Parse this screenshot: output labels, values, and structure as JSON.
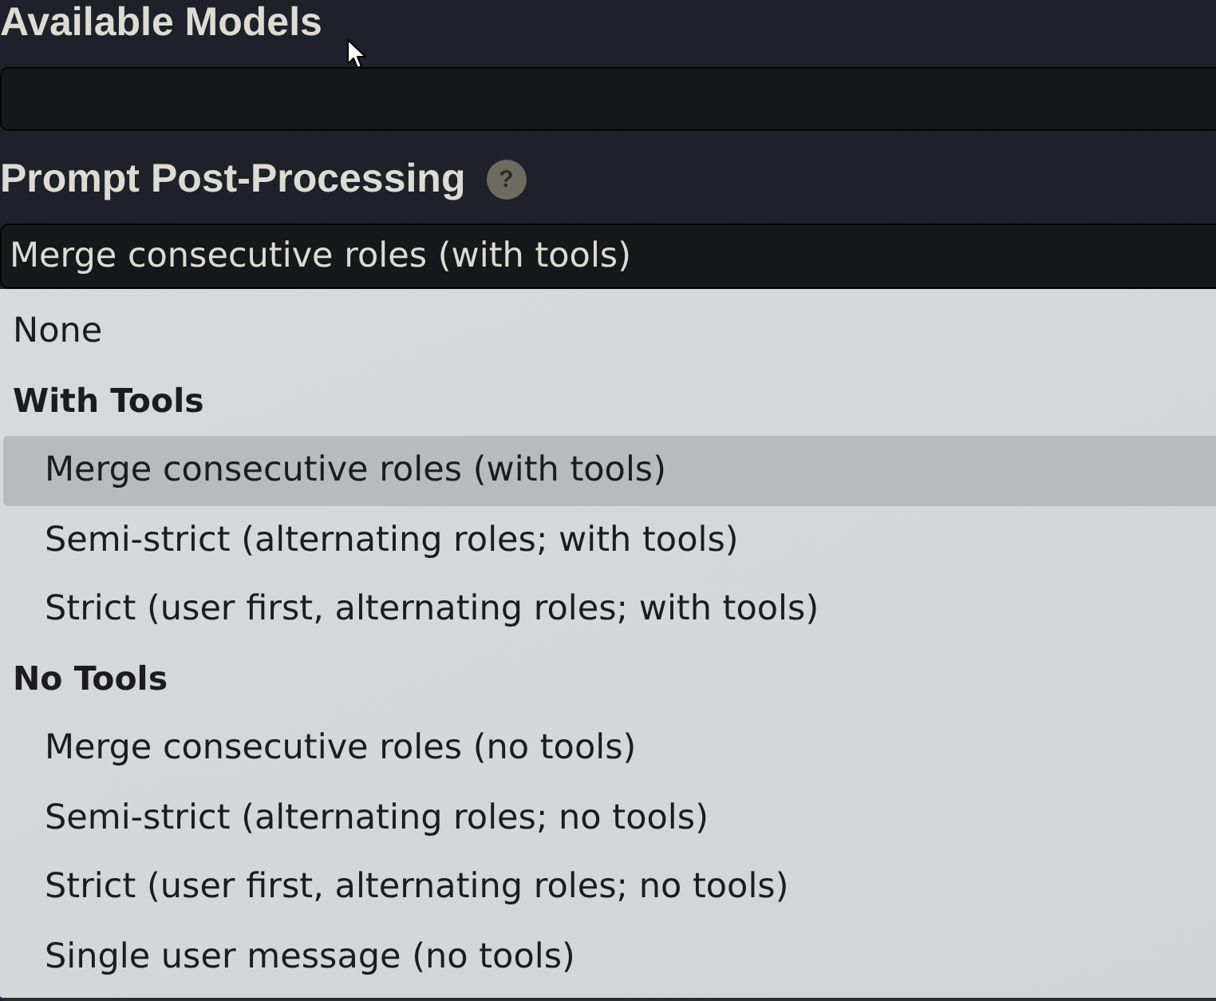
{
  "available_models": {
    "heading": "Available Models"
  },
  "prompt_post_processing": {
    "heading": "Prompt Post-Processing",
    "help": "?",
    "value": "Merge consecutive roles (with tools)",
    "expanded": true,
    "options": [
      {
        "kind": "option",
        "label": "None",
        "selected": false
      },
      {
        "kind": "group",
        "label": "With Tools",
        "children": [
          {
            "kind": "option",
            "label": "Merge consecutive roles (with tools)",
            "selected": true
          },
          {
            "kind": "option",
            "label": "Semi-strict (alternating roles; with tools)",
            "selected": false
          },
          {
            "kind": "option",
            "label": "Strict (user first, alternating roles; with tools)",
            "selected": false
          }
        ]
      },
      {
        "kind": "group",
        "label": "No Tools",
        "children": [
          {
            "kind": "option",
            "label": "Merge consecutive roles (no tools)",
            "selected": false
          },
          {
            "kind": "option",
            "label": "Semi-strict (alternating roles; no tools)",
            "selected": false
          },
          {
            "kind": "option",
            "label": "Strict (user first, alternating roles; no tools)",
            "selected": false
          },
          {
            "kind": "option",
            "label": "Single user message (no tools)",
            "selected": false
          }
        ]
      }
    ]
  }
}
